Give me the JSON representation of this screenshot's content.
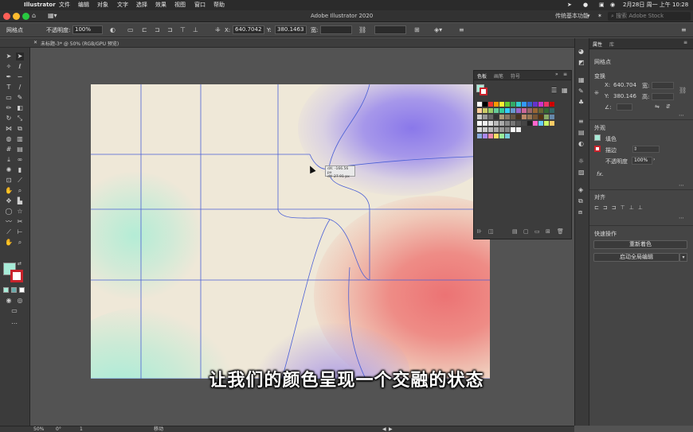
{
  "menubar": {
    "app": "Illustrator",
    "items": [
      "文件",
      "编辑",
      "对象",
      "文字",
      "选择",
      "效果",
      "视图",
      "窗口",
      "帮助"
    ],
    "clock": "2月28日 周一 上午 10:28"
  },
  "appbar": {
    "window_title": "Adobe Illustrator 2020",
    "workspace": "传统基本功能",
    "search_placeholder": "搜索 Adobe Stock"
  },
  "controlbar": {
    "selection_label": "网格点",
    "opacity_label": "不透明度:",
    "opacity_value": "100%",
    "x_label": "X:",
    "x_value": "640.7042",
    "y_label": "Y:",
    "y_value": "380.1463",
    "w_label": "宽:"
  },
  "document_tab": {
    "title": "未标题-3* @ 50% (RGB/GPU 预览)"
  },
  "canvas": {
    "tooltip_dx": "dX: -166.56 px",
    "tooltip_dy": "dY: 27.91 px",
    "subtitle": "让我们的颜色呈现一个交融的状态"
  },
  "swatches_panel": {
    "tabs": [
      "色板",
      "画笔",
      "符号"
    ]
  },
  "properties": {
    "tabs": [
      "属性",
      "库"
    ],
    "selection": "网格点",
    "transform_title": "变换",
    "x_label": "X:",
    "x_value": "640.704",
    "y_label": "Y:",
    "y_value": "380.146",
    "w_label": "宽:",
    "h_label": "高:",
    "angle_symbol": "∠:",
    "appearance_title": "外观",
    "fill_label": "填色",
    "stroke_label": "描边",
    "opacity_label": "不透明度",
    "opacity_value": "100%",
    "fx_label": "fx.",
    "align_title": "对齐",
    "quick_actions_title": "快速操作",
    "recolor_button": "重新着色",
    "global_edit_button": "启动全局编辑"
  },
  "statusbar": {
    "zoom": "50%",
    "rotation": "0°",
    "artboard": "1",
    "tool": "移动"
  },
  "colors": {
    "accent_fill": "#a8ecd8",
    "mesh_line": "#4a5fd6",
    "panel_bg": "#454545"
  }
}
